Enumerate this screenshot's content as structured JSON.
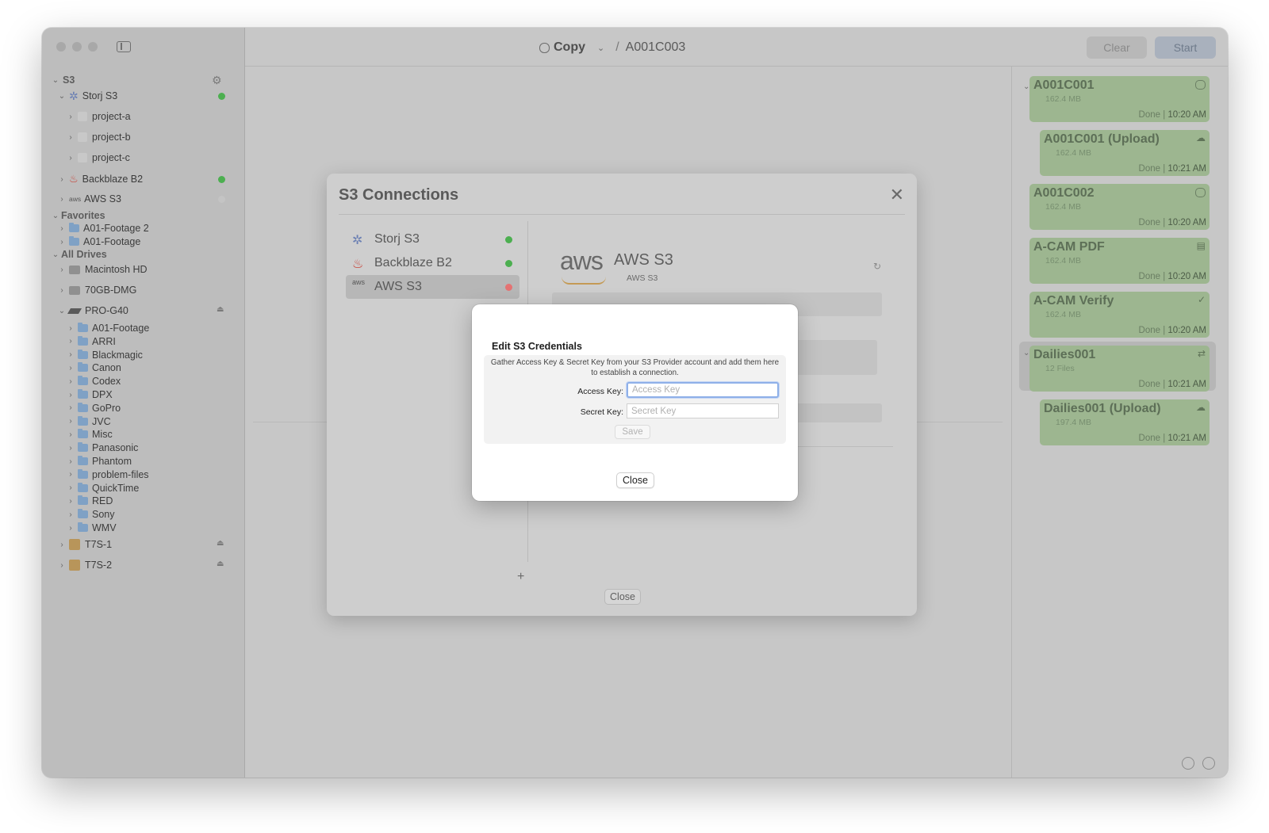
{
  "toolbar": {
    "mode_label": "Copy",
    "separator": "/",
    "path": "A001C003",
    "clear_label": "Clear",
    "start_label": "Start"
  },
  "sidebar": {
    "s3_section": "S3",
    "storj": "Storj S3",
    "buckets": [
      "project-a",
      "project-b",
      "project-c"
    ],
    "backblaze": "Backblaze B2",
    "aws": "AWS S3",
    "aws_logo_text": "aws",
    "favorites_section": "Favorites",
    "favorites": [
      "A01-Footage 2",
      "A01-Footage"
    ],
    "drives_section": "All Drives",
    "drives": [
      "Macintosh HD",
      "70GB-DMG"
    ],
    "pro_drive": "PRO-G40",
    "pro_folders": [
      "A01-Footage",
      "ARRI",
      "Blackmagic",
      "Canon",
      "Codex",
      "DPX",
      "GoPro",
      "JVC",
      "Misc",
      "Panasonic",
      "Phantom",
      "problem-files",
      "QuickTime",
      "RED",
      "Sony",
      "WMV"
    ],
    "external": [
      "T7S-1",
      "T7S-2"
    ]
  },
  "queue": [
    {
      "title": "A001C001",
      "size": "162.4 MB",
      "status": "Done",
      "time": "10:20 AM",
      "icon": "circle-icon"
    },
    {
      "title": "A001C001 (Upload)",
      "size": "162.4 MB",
      "status": "Done",
      "time": "10:21 AM",
      "icon": "cloud-upload-icon"
    },
    {
      "title": "A001C002",
      "size": "162.4 MB",
      "status": "Done",
      "time": "10:20 AM",
      "icon": "circle-icon"
    },
    {
      "title": "A-CAM PDF",
      "size": "162.4 MB",
      "status": "Done",
      "time": "10:20 AM",
      "icon": "document-icon"
    },
    {
      "title": "A-CAM Verify",
      "size": "162.4 MB",
      "status": "Done",
      "time": "10:20 AM",
      "icon": "checkmark-icon"
    },
    {
      "title": "Dailies001",
      "size": "12 Files",
      "status": "Done",
      "time": "10:21 AM",
      "icon": "transcode-icon"
    },
    {
      "title": "Dailies001 (Upload)",
      "size": "197.4 MB",
      "status": "Done",
      "time": "10:21 AM",
      "icon": "cloud-upload-icon"
    }
  ],
  "connections_dialog": {
    "title": "S3 Connections",
    "connections": [
      {
        "name": "Storj S3",
        "status_color": "#4caf50"
      },
      {
        "name": "Backblaze B2",
        "status_color": "#4caf50"
      },
      {
        "name": "AWS S3",
        "status_color": "#e53935"
      }
    ],
    "aws_logo_text": "aws",
    "detail_title": "AWS S3",
    "detail_subtitle": "AWS S3",
    "add_label": "+",
    "close_label": "Close"
  },
  "credentials_sheet": {
    "title": "Edit S3 Credentials",
    "description": "Gather Access Key & Secret Key from your S3 Provider account and add them here to establish a connection.",
    "access_key_label": "Access Key:",
    "access_key_placeholder": "Access Key",
    "access_key_value": "",
    "secret_key_label": "Secret Key:",
    "secret_key_placeholder": "Secret Key",
    "secret_key_value": "",
    "save_label": "Save",
    "close_label": "Close"
  },
  "colors": {
    "accent_focus": "#8fb0e8",
    "queue_card": "#9db690",
    "status_green": "#4caf50",
    "status_red": "#e53935"
  }
}
